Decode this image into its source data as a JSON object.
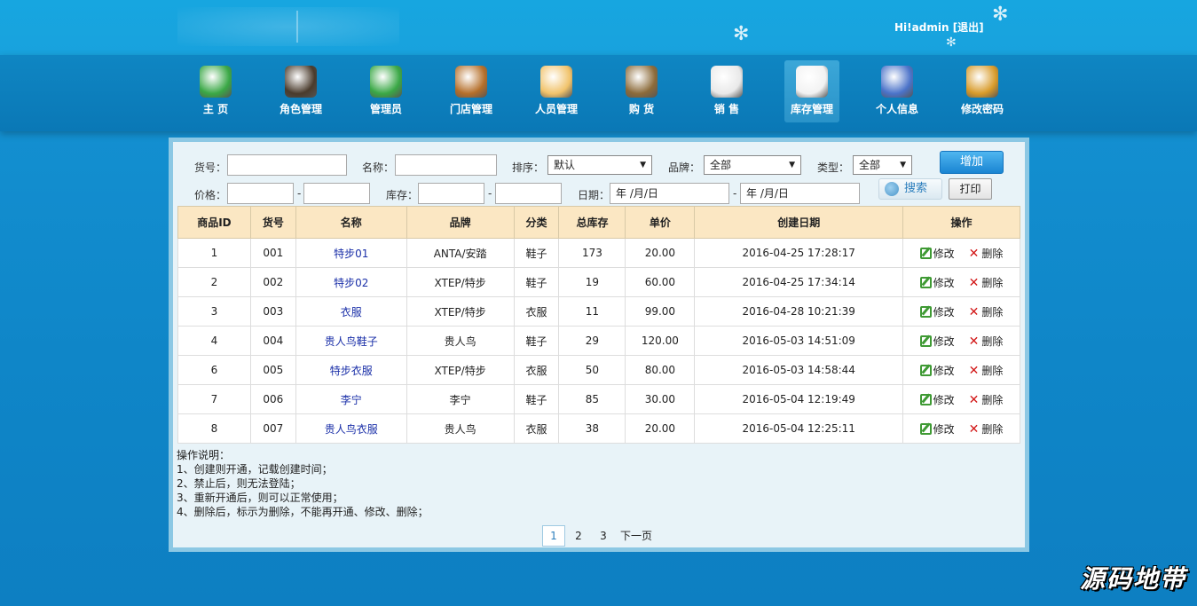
{
  "header": {
    "greeting": "Hi!",
    "username": "admin",
    "logout": "[退出]"
  },
  "nav": [
    {
      "label": "主 页",
      "icon": "home-icon",
      "color": "#3aa846"
    },
    {
      "label": "角色管理",
      "icon": "waiter-icon",
      "color": "#4a3b2c"
    },
    {
      "label": "管理员",
      "icon": "admin-user-icon",
      "color": "#3aa846"
    },
    {
      "label": "门店管理",
      "icon": "store-icon",
      "color": "#b56f2a"
    },
    {
      "label": "人员管理",
      "icon": "staff-card-icon",
      "color": "#f1c36b"
    },
    {
      "label": "购 货",
      "icon": "clipboard-icon",
      "color": "#8c6b3a"
    },
    {
      "label": "销 售",
      "icon": "sales-icon",
      "color": "#e9e9e9"
    },
    {
      "label": "库存管理",
      "icon": "inventory-doc-icon",
      "color": "#f2f2f2",
      "active": true
    },
    {
      "label": "个人信息",
      "icon": "users-icon",
      "color": "#4b73c9"
    },
    {
      "label": "修改密码",
      "icon": "lock-user-icon",
      "color": "#d89b2a"
    }
  ],
  "filters": {
    "sku_label": "货号：",
    "name_label": "名称：",
    "sort_label": "排序：",
    "sort_value": "默认",
    "brand_label": "品牌：",
    "brand_value": "全部",
    "type_label": "类型：",
    "type_value": "全部",
    "add_button": "增加",
    "price_label": "价格：",
    "stock_label": "库存：",
    "date_label": "日期：",
    "date_placeholder": "年 /月/日",
    "search_button": "搜索",
    "print_button": "打印",
    "range_dash": "-"
  },
  "table": {
    "columns": [
      "商品ID",
      "货号",
      "名称",
      "品牌",
      "分类",
      "总库存",
      "单价",
      "创建日期",
      "操作"
    ],
    "edit_label": "修改",
    "delete_label": "删除",
    "rows": [
      {
        "id": "1",
        "sku": "001",
        "name": "特步01",
        "brand": "ANTA/安踏",
        "category": "鞋子",
        "stock": "173",
        "price": "20.00",
        "created": "2016-04-25 17:28:17"
      },
      {
        "id": "2",
        "sku": "002",
        "name": "特步02",
        "brand": "XTEP/特步",
        "category": "鞋子",
        "stock": "19",
        "price": "60.00",
        "created": "2016-04-25 17:34:14"
      },
      {
        "id": "3",
        "sku": "003",
        "name": "衣服",
        "brand": "XTEP/特步",
        "category": "衣服",
        "stock": "11",
        "price": "99.00",
        "created": "2016-04-28 10:21:39"
      },
      {
        "id": "4",
        "sku": "004",
        "name": "贵人鸟鞋子",
        "brand": "贵人鸟",
        "category": "鞋子",
        "stock": "29",
        "price": "120.00",
        "created": "2016-05-03 14:51:09"
      },
      {
        "id": "6",
        "sku": "005",
        "name": "特步衣服",
        "brand": "XTEP/特步",
        "category": "衣服",
        "stock": "50",
        "price": "80.00",
        "created": "2016-05-03 14:58:44"
      },
      {
        "id": "7",
        "sku": "006",
        "name": "李宁",
        "brand": "李宁",
        "category": "鞋子",
        "stock": "85",
        "price": "30.00",
        "created": "2016-05-04 12:19:49"
      },
      {
        "id": "8",
        "sku": "007",
        "name": "贵人鸟衣服",
        "brand": "贵人鸟",
        "category": "衣服",
        "stock": "38",
        "price": "20.00",
        "created": "2016-05-04 12:25:11"
      }
    ]
  },
  "notes": [
    "操作说明：",
    "1、创建则开通，记载创建时间；",
    "2、禁止后，则无法登陆；",
    "3、重新开通后，则可以正常使用；",
    "4、删除后，标示为删除，不能再开通、修改、删除；"
  ],
  "pager": {
    "pages": [
      "1",
      "2",
      "3"
    ],
    "current": "1",
    "next": "下一页"
  },
  "watermark": "源码地带"
}
